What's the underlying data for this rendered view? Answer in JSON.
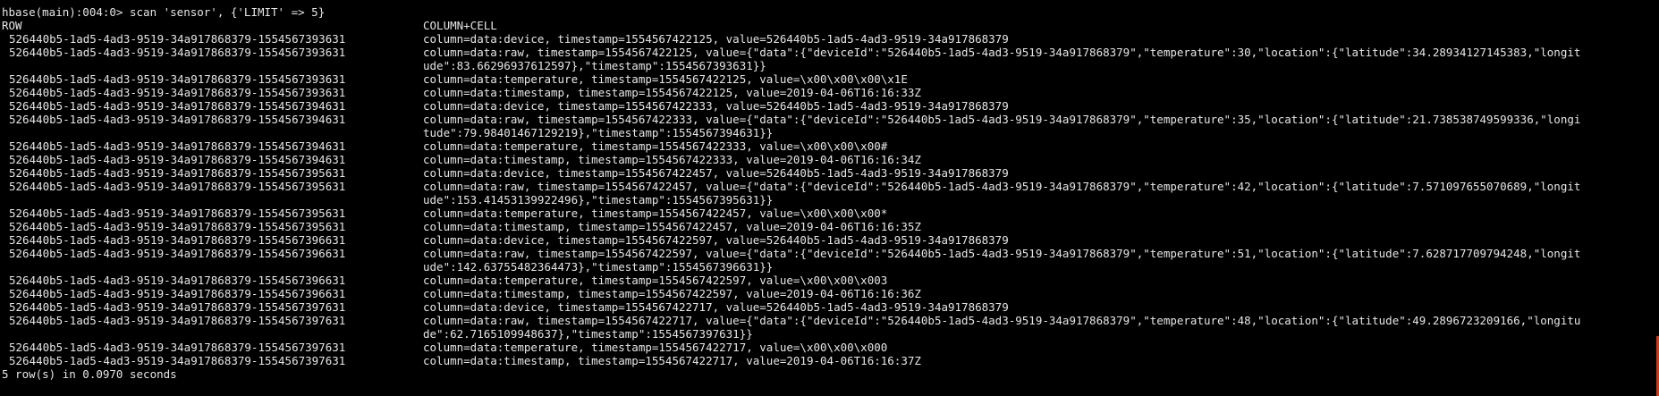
{
  "terminal": {
    "prompt": "hbase(main):004:0> scan 'sensor', {'LIMIT' => 5}",
    "header": {
      "row": "ROW",
      "column_cell": "COLUMN+CELL"
    },
    "lines": [
      {
        "row": "526440b5-1ad5-4ad3-9519-34a917868379-1554567393631",
        "cell": "column=data:device, timestamp=1554567422125, value=526440b5-1ad5-4ad3-9519-34a917868379"
      },
      {
        "row": "526440b5-1ad5-4ad3-9519-34a917868379-1554567393631",
        "cell": "column=data:raw, timestamp=1554567422125, value={\"data\":{\"deviceId\":\"526440b5-1ad5-4ad3-9519-34a917868379\",\"temperature\":30,\"location\":{\"latitude\":34.28934127145383,\"longit"
      },
      {
        "row": "",
        "cell": "ude\":83.66296937612597},\"timestamp\":1554567393631}}"
      },
      {
        "row": "526440b5-1ad5-4ad3-9519-34a917868379-1554567393631",
        "cell": "column=data:temperature, timestamp=1554567422125, value=\\x00\\x00\\x00\\x1E"
      },
      {
        "row": "526440b5-1ad5-4ad3-9519-34a917868379-1554567393631",
        "cell": "column=data:timestamp, timestamp=1554567422125, value=2019-04-06T16:16:33Z"
      },
      {
        "row": "526440b5-1ad5-4ad3-9519-34a917868379-1554567394631",
        "cell": "column=data:device, timestamp=1554567422333, value=526440b5-1ad5-4ad3-9519-34a917868379"
      },
      {
        "row": "526440b5-1ad5-4ad3-9519-34a917868379-1554567394631",
        "cell": "column=data:raw, timestamp=1554567422333, value={\"data\":{\"deviceId\":\"526440b5-1ad5-4ad3-9519-34a917868379\",\"temperature\":35,\"location\":{\"latitude\":21.738538749599336,\"longi"
      },
      {
        "row": "",
        "cell": "tude\":79.98401467129219},\"timestamp\":1554567394631}}"
      },
      {
        "row": "526440b5-1ad5-4ad3-9519-34a917868379-1554567394631",
        "cell": "column=data:temperature, timestamp=1554567422333, value=\\x00\\x00\\x00#"
      },
      {
        "row": "526440b5-1ad5-4ad3-9519-34a917868379-1554567394631",
        "cell": "column=data:timestamp, timestamp=1554567422333, value=2019-04-06T16:16:34Z"
      },
      {
        "row": "526440b5-1ad5-4ad3-9519-34a917868379-1554567395631",
        "cell": "column=data:device, timestamp=1554567422457, value=526440b5-1ad5-4ad3-9519-34a917868379"
      },
      {
        "row": "526440b5-1ad5-4ad3-9519-34a917868379-1554567395631",
        "cell": "column=data:raw, timestamp=1554567422457, value={\"data\":{\"deviceId\":\"526440b5-1ad5-4ad3-9519-34a917868379\",\"temperature\":42,\"location\":{\"latitude\":7.571097655070689,\"longit"
      },
      {
        "row": "",
        "cell": "ude\":153.41453139922496},\"timestamp\":1554567395631}}"
      },
      {
        "row": "526440b5-1ad5-4ad3-9519-34a917868379-1554567395631",
        "cell": "column=data:temperature, timestamp=1554567422457, value=\\x00\\x00\\x00*"
      },
      {
        "row": "526440b5-1ad5-4ad3-9519-34a917868379-1554567395631",
        "cell": "column=data:timestamp, timestamp=1554567422457, value=2019-04-06T16:16:35Z"
      },
      {
        "row": "526440b5-1ad5-4ad3-9519-34a917868379-1554567396631",
        "cell": "column=data:device, timestamp=1554567422597, value=526440b5-1ad5-4ad3-9519-34a917868379"
      },
      {
        "row": "526440b5-1ad5-4ad3-9519-34a917868379-1554567396631",
        "cell": "column=data:raw, timestamp=1554567422597, value={\"data\":{\"deviceId\":\"526440b5-1ad5-4ad3-9519-34a917868379\",\"temperature\":51,\"location\":{\"latitude\":7.628717709794248,\"longit"
      },
      {
        "row": "",
        "cell": "ude\":142.63755482364473},\"timestamp\":1554567396631}}"
      },
      {
        "row": "526440b5-1ad5-4ad3-9519-34a917868379-1554567396631",
        "cell": "column=data:temperature, timestamp=1554567422597, value=\\x00\\x00\\x003"
      },
      {
        "row": "526440b5-1ad5-4ad3-9519-34a917868379-1554567396631",
        "cell": "column=data:timestamp, timestamp=1554567422597, value=2019-04-06T16:16:36Z"
      },
      {
        "row": "526440b5-1ad5-4ad3-9519-34a917868379-1554567397631",
        "cell": "column=data:device, timestamp=1554567422717, value=526440b5-1ad5-4ad3-9519-34a917868379"
      },
      {
        "row": "526440b5-1ad5-4ad3-9519-34a917868379-1554567397631",
        "cell": "column=data:raw, timestamp=1554567422717, value={\"data\":{\"deviceId\":\"526440b5-1ad5-4ad3-9519-34a917868379\",\"temperature\":48,\"location\":{\"latitude\":49.2896723209166,\"longitu"
      },
      {
        "row": "",
        "cell": "de\":62.7165109948637},\"timestamp\":1554567397631}}"
      },
      {
        "row": "526440b5-1ad5-4ad3-9519-34a917868379-1554567397631",
        "cell": "column=data:temperature, timestamp=1554567422717, value=\\x00\\x00\\x000"
      },
      {
        "row": "526440b5-1ad5-4ad3-9519-34a917868379-1554567397631",
        "cell": "column=data:timestamp, timestamp=1554567422717, value=2019-04-06T16:16:37Z"
      }
    ],
    "summary": "5 row(s) in 0.0970 seconds"
  },
  "colors": {
    "background": "#000000",
    "text": "#e6e6e6",
    "accent_edge": "#cc3b1a"
  }
}
